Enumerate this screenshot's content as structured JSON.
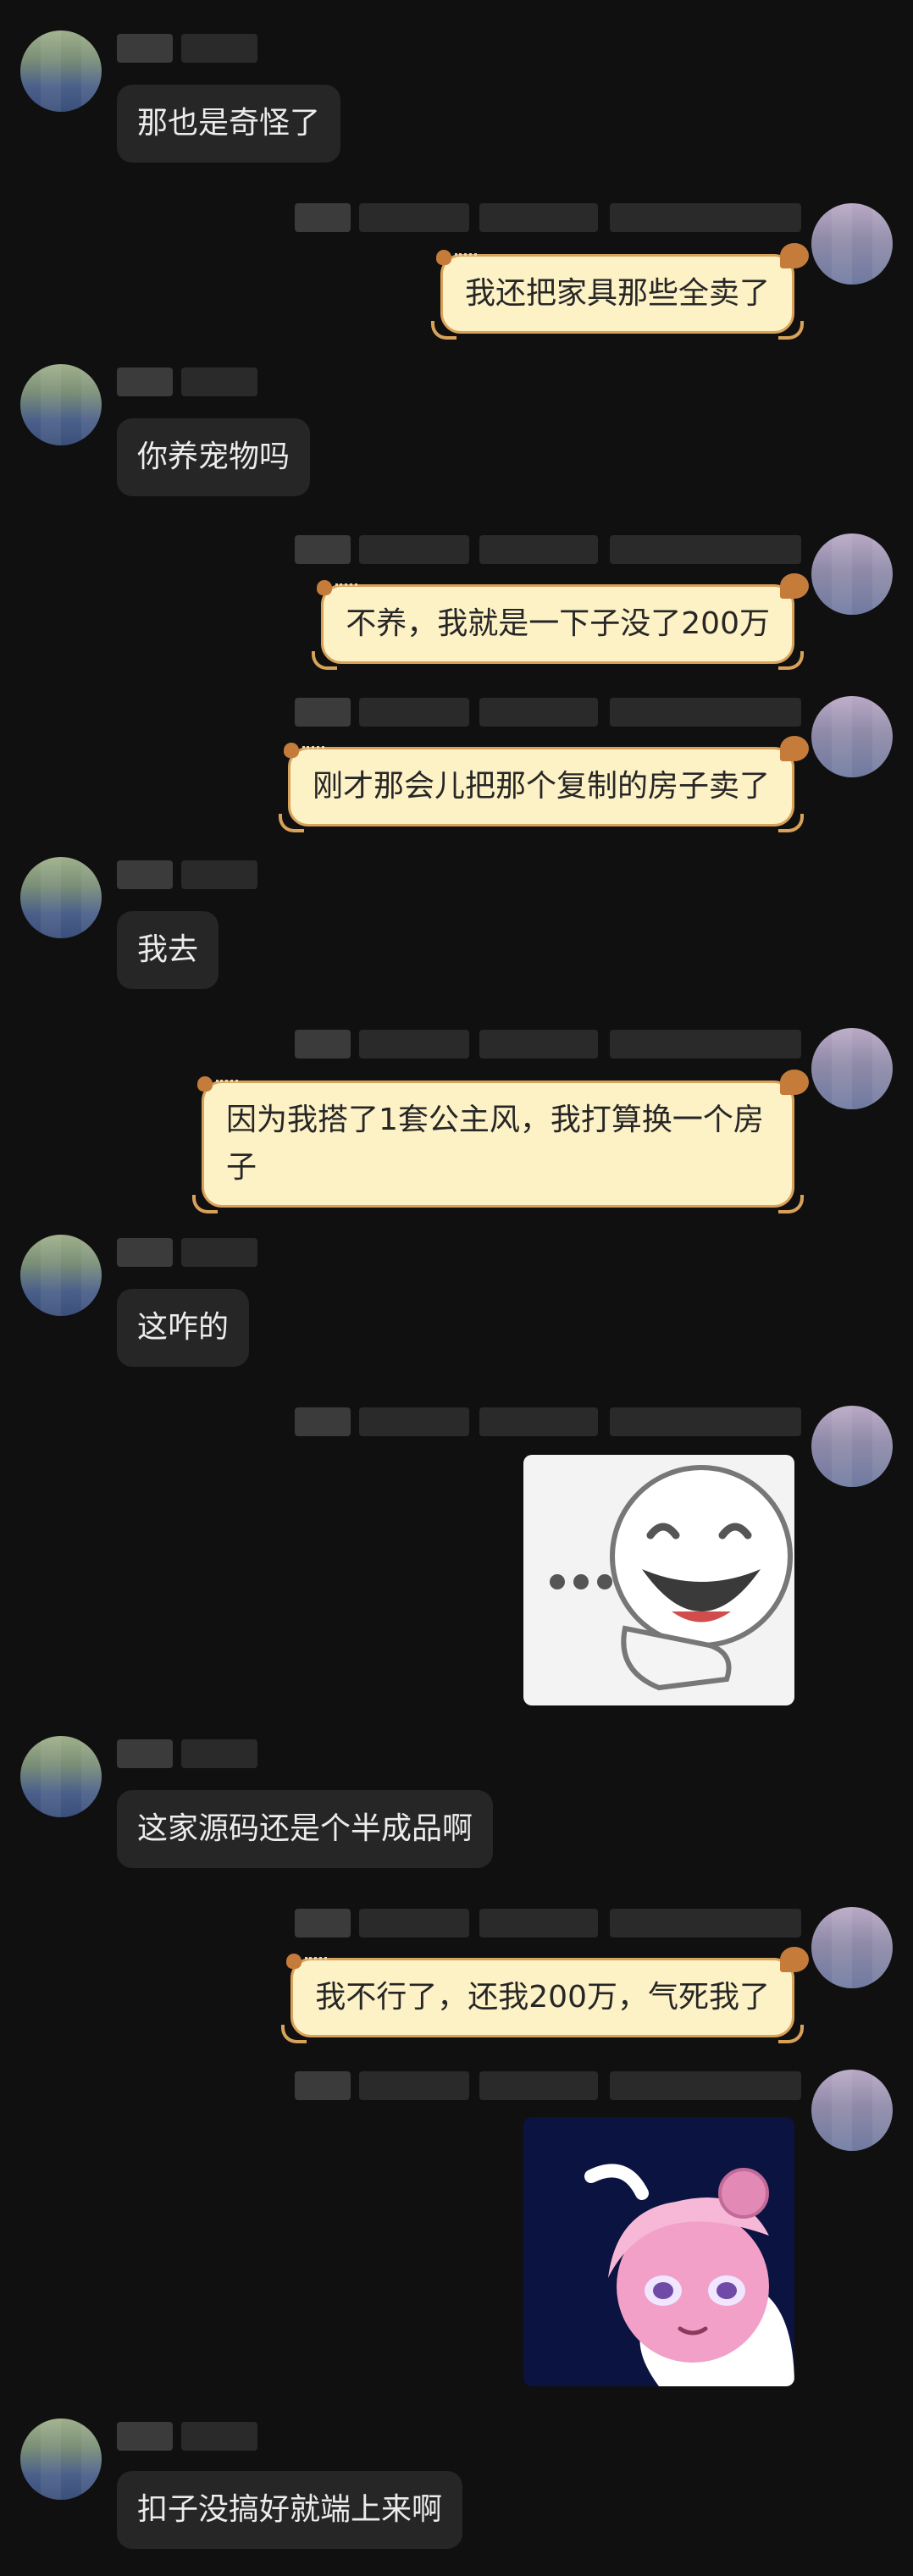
{
  "messages": [
    {
      "side": "left",
      "type": "text",
      "text": "那也是奇怪了"
    },
    {
      "side": "right",
      "type": "text",
      "text": "我还把家具那些全卖了"
    },
    {
      "side": "left",
      "type": "text",
      "text": "你养宠物吗"
    },
    {
      "side": "right",
      "type": "text",
      "text": "不养，我就是一下子没了200万"
    },
    {
      "side": "right",
      "type": "text",
      "text": "刚才那会儿把那个复制的房子卖了"
    },
    {
      "side": "left",
      "type": "text",
      "text": "我去"
    },
    {
      "side": "right",
      "type": "text",
      "text": "因为我搭了1套公主风，我打算换一个房子"
    },
    {
      "side": "left",
      "type": "text",
      "text": "这咋的"
    },
    {
      "side": "right",
      "type": "sticker",
      "icon": "laughing-face-sticker"
    },
    {
      "side": "left",
      "type": "text",
      "text": "这家源码还是个半成品啊"
    },
    {
      "side": "right",
      "type": "text",
      "text": "我不行了，还我200万，气死我了"
    },
    {
      "side": "right",
      "type": "sticker",
      "icon": "anime-girl-sticker"
    },
    {
      "side": "left",
      "type": "text",
      "text": "扣子没搞好就端上来啊"
    }
  ],
  "colors": {
    "background": "#101010",
    "left_bubble": "#262626",
    "right_bubble": "#fdf1c6",
    "right_border": "#d9a25a"
  }
}
